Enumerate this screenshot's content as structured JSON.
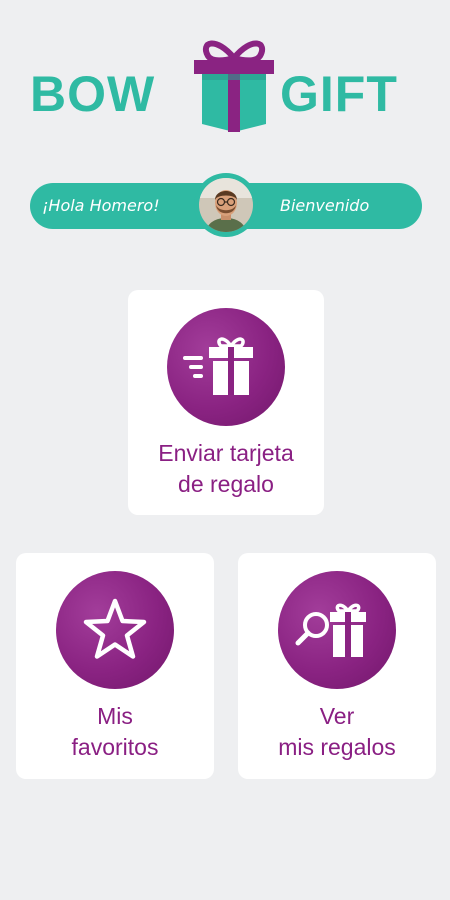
{
  "logo": {
    "left_word": "BOW",
    "right_word": "GIFT"
  },
  "greeting": {
    "hello": "¡Hola Homero!",
    "welcome": "Bienvenido",
    "avatar_icon": "user-avatar-photo"
  },
  "cards": [
    {
      "label": "Enviar tarjeta\nde regalo",
      "icon": "send-gift-icon"
    },
    {
      "label": "Mis\nfavoritos",
      "icon": "star-icon"
    },
    {
      "label": "Ver\nmis regalos",
      "icon": "search-gift-icon"
    }
  ],
  "colors": {
    "brand_teal": "#2fbaa3",
    "brand_purple": "#8a2382",
    "background": "#eeeff1",
    "card_background": "#ffffff"
  }
}
